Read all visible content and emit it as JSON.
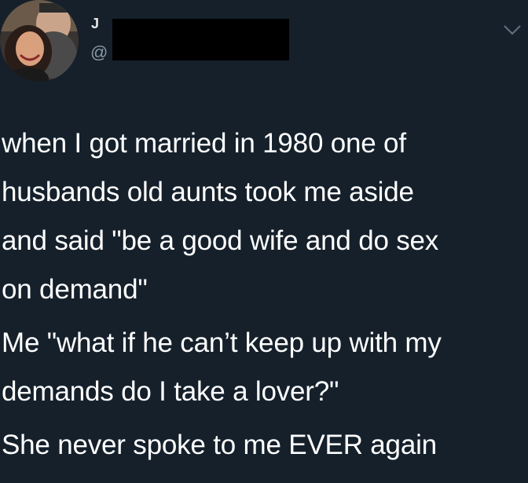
{
  "tweet": {
    "author": {
      "avatar_icon": "profile-photo",
      "name_visible_fragment": "J",
      "handle_visible_fragment": "@"
    },
    "menu_icon": "chevron-down-icon",
    "paragraphs": [
      {
        "lines": [
          "when I got married in 1980 one of",
          "husbands old aunts took me aside",
          "and said  \"be a good wife and do sex",
          "on demand\""
        ]
      },
      {
        "lines": [
          "Me \"what if he can’t keep up with my",
          "demands do I take a lover?\""
        ]
      },
      {
        "lines": [
          "She never spoke to me EVER again"
        ]
      }
    ]
  },
  "colors": {
    "background": "#15202b",
    "text": "#ffffff",
    "secondary_text": "#8899a6",
    "redaction": "#000000"
  }
}
